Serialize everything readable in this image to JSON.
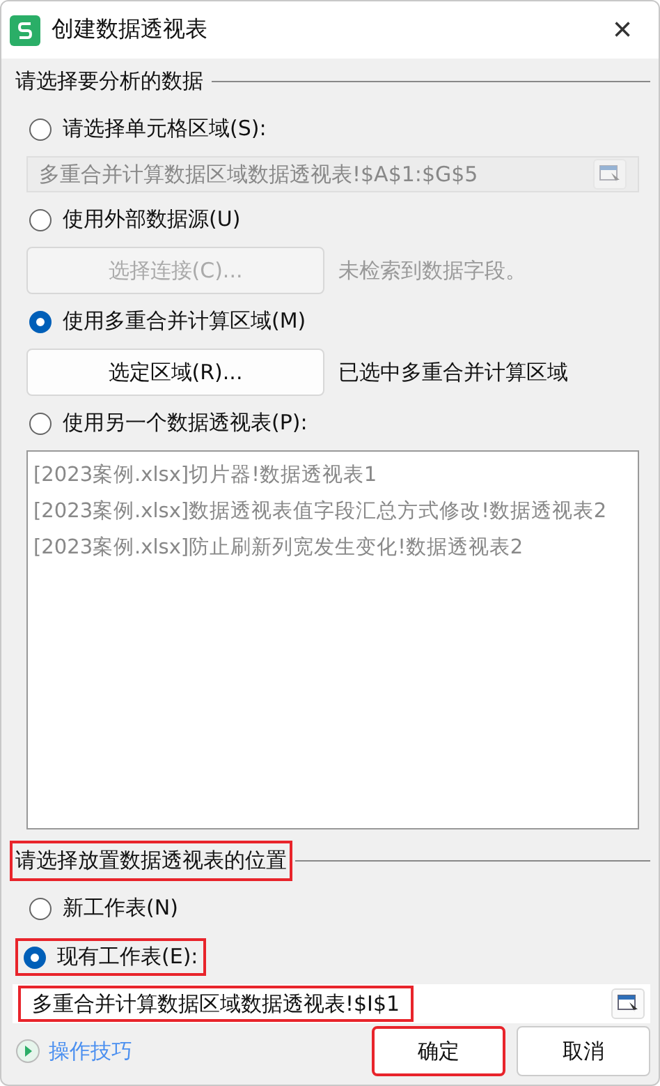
{
  "window": {
    "title": "创建数据透视表",
    "close": "×"
  },
  "source_section": {
    "title": "请选择要分析的数据",
    "options": [
      {
        "kind": "range",
        "label": "请选择单元格区域(S):",
        "selected": false,
        "field": "多重合并计算数据区域数据透视表!$A$1:$G$5",
        "disabled": true
      },
      {
        "kind": "button",
        "label": "使用外部数据源(U)",
        "selected": false,
        "button": "选择连接(C)...",
        "note": "未检索到数据字段。",
        "disabled": true
      },
      {
        "kind": "button",
        "label": "使用多重合并计算区域(M)",
        "selected": true,
        "button": "选定区域(R)...",
        "note": "已选中多重合并计算区域",
        "disabled": false
      },
      {
        "kind": "list",
        "label": "使用另一个数据透视表(P):",
        "selected": false,
        "items": [
          "[2023案例.xlsx]切片器!数据透视表1",
          "[2023案例.xlsx]数据透视表值字段汇总方式修改!数据透视表2",
          "[2023案例.xlsx]防止刷新列宽发生变化!数据透视表2"
        ],
        "disabled": true
      }
    ]
  },
  "target_section": {
    "title": "请选择放置数据透视表的位置",
    "highlighted": true,
    "options": [
      {
        "label": "新工作表(N)",
        "selected": false,
        "highlighted": false
      },
      {
        "label": "现有工作表(E):",
        "selected": true,
        "highlighted": true
      }
    ],
    "field": {
      "value": "多重合并计算数据区域数据透视表!$I$1",
      "highlighted": true
    }
  },
  "footer": {
    "tips": "操作技巧",
    "buttons": [
      {
        "label": "确定",
        "highlighted": true
      },
      {
        "label": "取消",
        "highlighted": false
      }
    ]
  }
}
